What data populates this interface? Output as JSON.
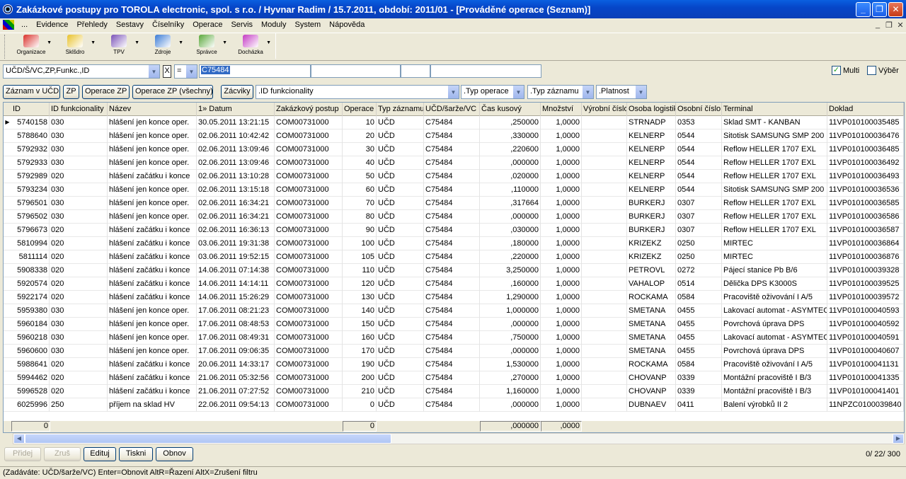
{
  "window": {
    "title": "Zakázkové postupy pro TOROLA electronic, spol. s r.o. / Hyvnar Radim / 15.7.2011, období: 2011/01 - [Prováděné operace (Seznam)]",
    "min_glyph": "_",
    "max_glyph": "❐",
    "close_glyph": "✕"
  },
  "menu": {
    "dots": "...",
    "items": [
      "Evidence",
      "Přehledy",
      "Sestavy",
      "Číselníky",
      "Operace",
      "Servis",
      "Moduly",
      "System",
      "Nápověda"
    ],
    "mdi_min": "_",
    "mdi_restore": "❐",
    "mdi_close": "✕"
  },
  "toolbar": {
    "buttons": [
      {
        "label": "Organizace",
        "icon": "organization-icon",
        "color": "#d9302a"
      },
      {
        "label": "Sklšdro",
        "icon": "warehouse-icon",
        "color": "#e8c22c"
      },
      {
        "label": "TPV",
        "icon": "tpv-icon",
        "color": "#7a52b8"
      },
      {
        "label": "Zdroje",
        "icon": "resources-icon",
        "color": "#3a7bd5"
      },
      {
        "label": "Správce",
        "icon": "admin-icon",
        "color": "#5aa83a"
      },
      {
        "label": "Docházka",
        "icon": "attendance-icon",
        "color": "#c43ac4"
      }
    ]
  },
  "filter": {
    "field_select": "UČD/Š/VC,ZP,Funkc.,ID",
    "clear_glyph": "X",
    "operator": "=",
    "value": "C75484",
    "multi_label": "Multi",
    "multi_checked": true,
    "vyber_label": "Výběr",
    "vyber_checked": false
  },
  "buttons": {
    "zaznam_ucd": "Záznam v UČD",
    "zp": "ZP",
    "operace_zp": "Operace ZP",
    "operace_zp_all": "Operace ZP (všechny)",
    "zaciky": "Zácviky",
    "id_funkcionality": ".ID funkcionality",
    "typ_operace": ".Typ operace",
    "typ_zaznamu": ".Typ záznamu",
    "platnost": ".Platnost"
  },
  "grid": {
    "columns": [
      "ID",
      "ID funkcionality",
      "Název",
      "1» Datum",
      "Zakázkový postup",
      "Operace",
      "Typ záznamu",
      "UČD/šarže/VC",
      "Čas kusový",
      "Množství",
      "Výrobní číslo",
      "Osoba logistik",
      "Osobní číslo",
      "Terminal",
      "Doklad"
    ],
    "rows": [
      [
        "5740158",
        "030",
        "hlášení jen konce oper.",
        "30.05.2011 13:21:15",
        "COM00731000",
        "10",
        "UČD",
        "C75484",
        ",250000",
        "1,0000",
        "",
        "STRNADP",
        "0353",
        "Sklad SMT - KANBAN",
        "11VP010100035485"
      ],
      [
        "5788640",
        "030",
        "hlášení jen konce oper.",
        "02.06.2011 10:42:42",
        "COM00731000",
        "20",
        "UČD",
        "C75484",
        ",330000",
        "1,0000",
        "",
        "KELNERP",
        "0544",
        "Sitotisk SAMSUNG SMP 200",
        "11VP010100036476"
      ],
      [
        "5792932",
        "030",
        "hlášení jen konce oper.",
        "02.06.2011 13:09:46",
        "COM00731000",
        "30",
        "UČD",
        "C75484",
        ",220600",
        "1,0000",
        "",
        "KELNERP",
        "0544",
        "Reflow HELLER 1707 EXL",
        "11VP010100036485"
      ],
      [
        "5792933",
        "030",
        "hlášení jen konce oper.",
        "02.06.2011 13:09:46",
        "COM00731000",
        "40",
        "UČD",
        "C75484",
        ",000000",
        "1,0000",
        "",
        "KELNERP",
        "0544",
        "Reflow HELLER 1707 EXL",
        "11VP010100036492"
      ],
      [
        "5792989",
        "020",
        "hlášení začátku i konce",
        "02.06.2011 13:10:28",
        "COM00731000",
        "50",
        "UČD",
        "C75484",
        ",020000",
        "1,0000",
        "",
        "KELNERP",
        "0544",
        "Reflow HELLER 1707 EXL",
        "11VP010100036493"
      ],
      [
        "5793234",
        "030",
        "hlášení jen konce oper.",
        "02.06.2011 13:15:18",
        "COM00731000",
        "60",
        "UČD",
        "C75484",
        ",110000",
        "1,0000",
        "",
        "KELNERP",
        "0544",
        "Sitotisk SAMSUNG SMP 200",
        "11VP010100036536"
      ],
      [
        "5796501",
        "030",
        "hlášení jen konce oper.",
        "02.06.2011 16:34:21",
        "COM00731000",
        "70",
        "UČD",
        "C75484",
        ",317664",
        "1,0000",
        "",
        "BURKERJ",
        "0307",
        "Reflow HELLER 1707 EXL",
        "11VP010100036585"
      ],
      [
        "5796502",
        "030",
        "hlášení jen konce oper.",
        "02.06.2011 16:34:21",
        "COM00731000",
        "80",
        "UČD",
        "C75484",
        ",000000",
        "1,0000",
        "",
        "BURKERJ",
        "0307",
        "Reflow HELLER 1707 EXL",
        "11VP010100036586"
      ],
      [
        "5796673",
        "020",
        "hlášení začátku i konce",
        "02.06.2011 16:36:13",
        "COM00731000",
        "90",
        "UČD",
        "C75484",
        ",030000",
        "1,0000",
        "",
        "BURKERJ",
        "0307",
        "Reflow HELLER 1707 EXL",
        "11VP010100036587"
      ],
      [
        "5810994",
        "020",
        "hlášení začátku i konce",
        "03.06.2011 19:31:38",
        "COM00731000",
        "100",
        "UČD",
        "C75484",
        ",180000",
        "1,0000",
        "",
        "KRIZEKZ",
        "0250",
        "MIRTEC",
        "11VP010100036864"
      ],
      [
        "5811114",
        "020",
        "hlášení začátku i konce",
        "03.06.2011 19:52:15",
        "COM00731000",
        "105",
        "UČD",
        "C75484",
        ",220000",
        "1,0000",
        "",
        "KRIZEKZ",
        "0250",
        "MIRTEC",
        "11VP010100036876"
      ],
      [
        "5908338",
        "020",
        "hlášení začátku i konce",
        "14.06.2011 07:14:38",
        "COM00731000",
        "110",
        "UČD",
        "C75484",
        "3,250000",
        "1,0000",
        "",
        "PETROVL",
        "0272",
        "Pájecí stanice Pb B/6",
        "11VP010100039328"
      ],
      [
        "5920574",
        "020",
        "hlášení začátku i konce",
        "14.06.2011 14:14:11",
        "COM00731000",
        "120",
        "UČD",
        "C75484",
        ",160000",
        "1,0000",
        "",
        "VAHALOP",
        "0514",
        "Dělička DPS K3000S",
        "11VP010100039525"
      ],
      [
        "5922174",
        "020",
        "hlášení začátku i konce",
        "14.06.2011 15:26:29",
        "COM00731000",
        "130",
        "UČD",
        "C75484",
        "1,290000",
        "1,0000",
        "",
        "ROCKAMA",
        "0584",
        "Pracoviště oživování I A/5",
        "11VP010100039572"
      ],
      [
        "5959380",
        "030",
        "hlášení jen konce oper.",
        "17.06.2011 08:21:23",
        "COM00731000",
        "140",
        "UČD",
        "C75484",
        "1,000000",
        "1,0000",
        "",
        "SMETANA",
        "0455",
        "Lakovací automat - ASYMTEC",
        "11VP010100040593"
      ],
      [
        "5960184",
        "030",
        "hlášení jen konce oper.",
        "17.06.2011 08:48:53",
        "COM00731000",
        "150",
        "UČD",
        "C75484",
        ",000000",
        "1,0000",
        "",
        "SMETANA",
        "0455",
        "Povrchová úprava DPS",
        "11VP010100040592"
      ],
      [
        "5960218",
        "030",
        "hlášení jen konce oper.",
        "17.06.2011 08:49:31",
        "COM00731000",
        "160",
        "UČD",
        "C75484",
        ",750000",
        "1,0000",
        "",
        "SMETANA",
        "0455",
        "Lakovací automat - ASYMTEC",
        "11VP010100040591"
      ],
      [
        "5960600",
        "030",
        "hlášení jen konce oper.",
        "17.06.2011 09:06:35",
        "COM00731000",
        "170",
        "UČD",
        "C75484",
        ",000000",
        "1,0000",
        "",
        "SMETANA",
        "0455",
        "Povrchová úprava DPS",
        "11VP010100040607"
      ],
      [
        "5988641",
        "020",
        "hlášení začátku i konce",
        "20.06.2011 14:33:17",
        "COM00731000",
        "190",
        "UČD",
        "C75484",
        "1,530000",
        "1,0000",
        "",
        "ROCKAMA",
        "0584",
        "Pracoviště oživování I A/5",
        "11VP010100041131"
      ],
      [
        "5994462",
        "020",
        "hlášení začátku i konce",
        "21.06.2011 05:32:56",
        "COM00731000",
        "200",
        "UČD",
        "C75484",
        ",270000",
        "1,0000",
        "",
        "CHOVANP",
        "0339",
        "Montážní pracoviště I B/3",
        "11VP010100041335"
      ],
      [
        "5996528",
        "020",
        "hlášení začátku i konce",
        "21.06.2011 07:27:52",
        "COM00731000",
        "210",
        "UČD",
        "C75484",
        "1,160000",
        "1,0000",
        "",
        "CHOVANP",
        "0339",
        "Montážní pracoviště I B/3",
        "11VP010100041401"
      ],
      [
        "6025996",
        "250",
        "příjem na sklad HV",
        "22.06.2011 09:54:13",
        "COM00731000",
        "0",
        "UČD",
        "C75484",
        ",000000",
        "1,0000",
        "",
        "DUBNAEV",
        "0411",
        "Balení výrobků II 2",
        "11NPZC0100039840"
      ]
    ],
    "footer": {
      "id_sum": "0",
      "operace_sum": "0",
      "cas_sum": ",000000",
      "mnozstvi_sum": ",0000"
    }
  },
  "actions": {
    "pridej": "Přidej",
    "zrus": "Zruš",
    "edituj": "Edituj",
    "tiskni": "Tiskni",
    "obnov": "Obnov",
    "counter": "0/  22/ 300"
  },
  "status": {
    "text": "(Zadáváte: UČD/šarže/VC)   Enter=Obnovit  AltR=Řazení  AltX=Zrušení filtru"
  }
}
